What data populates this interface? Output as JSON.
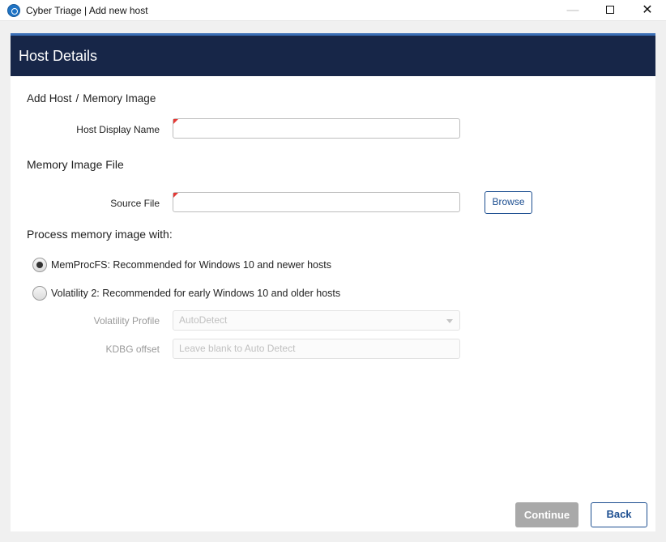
{
  "window": {
    "title": "Cyber Triage | Add new host",
    "minimize": "—",
    "close": "✕"
  },
  "dialog": {
    "header": "Host Details",
    "breadcrumb": {
      "parent": "Add Host",
      "separator": "/",
      "current": "Memory Image"
    },
    "host_display_name": {
      "label": "Host Display Name",
      "value": ""
    },
    "memory_section_title": "Memory Image File",
    "source_file": {
      "label": "Source File",
      "value": ""
    },
    "browse_label": "Browse",
    "process_title": "Process memory image with:",
    "options": [
      {
        "label": "MemProcFS: Recommended for Windows 10 and newer hosts",
        "checked": true
      },
      {
        "label": "Volatility 2: Recommended for early Windows 10 and older hosts",
        "checked": false
      }
    ],
    "volatility_profile": {
      "label": "Volatility Profile",
      "value": "AutoDetect"
    },
    "kdbg_offset": {
      "label": "KDBG offset",
      "placeholder": "Leave blank to Auto Detect"
    },
    "continue_label": "Continue",
    "back_label": "Back"
  },
  "colors": {
    "header_bg": "#172648",
    "accent": "#1d4f91",
    "required_marker": "#e53935",
    "disabled_button": "#a9a9a9"
  },
  "icons": {
    "app": "cyber-triage-logo-icon",
    "maximize": "maximize-icon",
    "close": "close-icon",
    "dropdown": "chevron-down-icon"
  }
}
